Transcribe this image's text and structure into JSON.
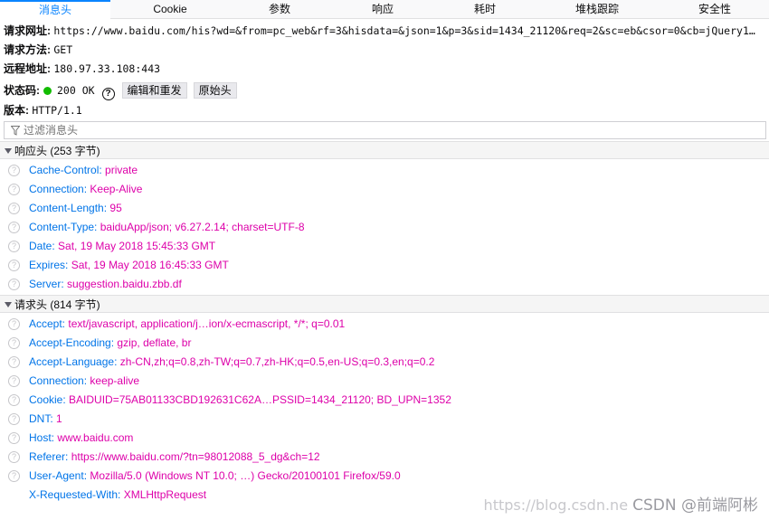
{
  "tabs": [
    "消息头",
    "Cookie",
    "参数",
    "响应",
    "耗时",
    "堆栈跟踪",
    "安全性"
  ],
  "summary": {
    "url_label": "请求网址:",
    "url_value": "https://www.baidu.com/his?wd=&from=pc_web&rf=3&hisdata=&json=1&p=3&sid=1434_21120&req=2&sc=eb&csor=0&cb=jQuery1…",
    "method_label": "请求方法:",
    "method_value": "GET",
    "remote_label": "远程地址:",
    "remote_value": "180.97.33.108:443",
    "status_label": "状态码:",
    "status_value": "200 OK",
    "status_color": "#12bc00",
    "edit_resend_label": "编辑和重发",
    "raw_headers_label": "原始头",
    "version_label": "版本:",
    "version_value": "HTTP/1.1"
  },
  "filter": {
    "placeholder": "过滤消息头"
  },
  "response_headers": {
    "title": "响应头 (253 字节)",
    "items": [
      {
        "name": "Cache-Control:",
        "value": "private"
      },
      {
        "name": "Connection:",
        "value": "Keep-Alive"
      },
      {
        "name": "Content-Length:",
        "value": "95"
      },
      {
        "name": "Content-Type:",
        "value": "baiduApp/json; v6.27.2.14; charset=UTF-8"
      },
      {
        "name": "Date:",
        "value": "Sat, 19 May 2018 15:45:33 GMT"
      },
      {
        "name": "Expires:",
        "value": "Sat, 19 May 2018 16:45:33 GMT"
      },
      {
        "name": "Server:",
        "value": "suggestion.baidu.zbb.df"
      }
    ]
  },
  "request_headers": {
    "title": "请求头 (814 字节)",
    "items": [
      {
        "name": "Accept:",
        "value": "text/javascript, application/j…ion/x-ecmascript, */*; q=0.01"
      },
      {
        "name": "Accept-Encoding:",
        "value": "gzip, deflate, br"
      },
      {
        "name": "Accept-Language:",
        "value": "zh-CN,zh;q=0.8,zh-TW;q=0.7,zh-HK;q=0.5,en-US;q=0.3,en;q=0.2"
      },
      {
        "name": "Connection:",
        "value": "keep-alive"
      },
      {
        "name": "Cookie:",
        "value": "BAIDUID=75AB01133CBD192631C62A…PSSID=1434_21120; BD_UPN=1352"
      },
      {
        "name": "DNT:",
        "value": "1"
      },
      {
        "name": "Host:",
        "value": "www.baidu.com"
      },
      {
        "name": "Referer:",
        "value": "https://www.baidu.com/?tn=98012088_5_dg&ch=12"
      },
      {
        "name": "User-Agent:",
        "value": "Mozilla/5.0 (Windows NT 10.0; …) Gecko/20100101 Firefox/59.0"
      },
      {
        "name": "X-Requested-With:",
        "value": "XMLHttpRequest"
      }
    ]
  },
  "watermark": {
    "url": "https://blog.csdn.ne",
    "brand": "CSDN @前端阿彬"
  },
  "colors": {
    "accent": "#0a84ff",
    "header_name": "#0074e8",
    "header_value": "#dd00a9"
  }
}
